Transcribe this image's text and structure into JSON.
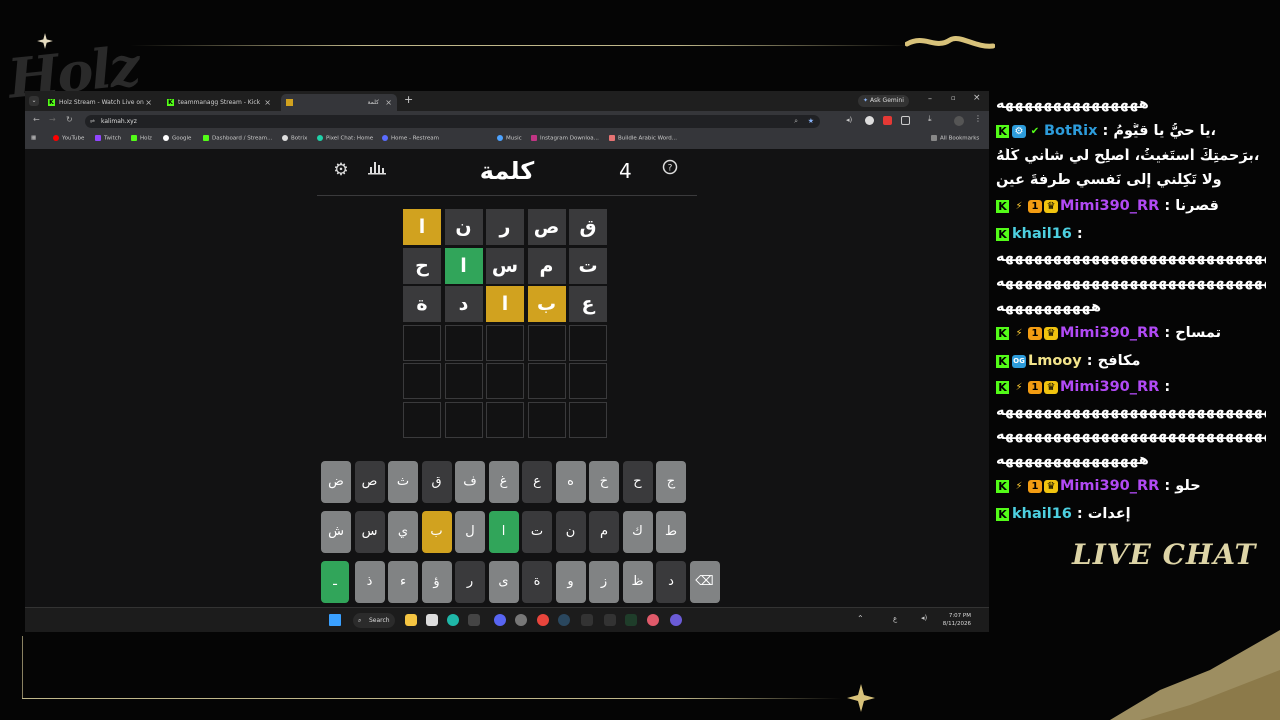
{
  "overlay": {
    "logo": "Holz",
    "live_chat": "LIVE CHAT"
  },
  "browser": {
    "tabs": [
      {
        "label": "Holz Stream - Watch Live on Kick",
        "active": false
      },
      {
        "label": "teammanagg Stream - Kick Dash...",
        "active": false
      },
      {
        "label": "كلمة",
        "active": true
      }
    ],
    "ask_gemini": "Ask Gemini",
    "url": "kalimah.xyz",
    "bookmarks": [
      "YouTube",
      "Twitch",
      "Holz",
      "Google",
      "Dashboard / Stream...",
      "Botrix",
      "Pixel Chat: Home",
      "Home - Restream",
      "Music",
      "Instagram Downloa...",
      "Buildle Arabic Word..."
    ],
    "all_bookmarks": "All Bookmarks"
  },
  "game": {
    "title": "كلمة",
    "score": "4",
    "colors": {
      "gray": "#3a3a3c",
      "green": "#31a55a",
      "yellow": "#d1a21f",
      "key": "#818384"
    },
    "rows": [
      [
        {
          "l": "ق",
          "s": "gray"
        },
        {
          "l": "ص",
          "s": "gray"
        },
        {
          "l": "ر",
          "s": "gray"
        },
        {
          "l": "ن",
          "s": "gray"
        },
        {
          "l": "ا",
          "s": "yellow"
        }
      ],
      [
        {
          "l": "ت",
          "s": "gray"
        },
        {
          "l": "م",
          "s": "gray"
        },
        {
          "l": "س",
          "s": "gray"
        },
        {
          "l": "ا",
          "s": "green"
        },
        {
          "l": "ح",
          "s": "gray"
        }
      ],
      [
        {
          "l": "ع",
          "s": "gray"
        },
        {
          "l": "ب",
          "s": "yellow"
        },
        {
          "l": "ا",
          "s": "yellow"
        },
        {
          "l": "د",
          "s": "gray"
        },
        {
          "l": "ة",
          "s": "gray"
        }
      ],
      [
        {
          "l": "",
          "s": "empty"
        },
        {
          "l": "",
          "s": "empty"
        },
        {
          "l": "",
          "s": "empty"
        },
        {
          "l": "",
          "s": "empty"
        },
        {
          "l": "",
          "s": "empty"
        }
      ],
      [
        {
          "l": "",
          "s": "empty"
        },
        {
          "l": "",
          "s": "empty"
        },
        {
          "l": "",
          "s": "empty"
        },
        {
          "l": "",
          "s": "empty"
        },
        {
          "l": "",
          "s": "empty"
        }
      ],
      [
        {
          "l": "",
          "s": "empty"
        },
        {
          "l": "",
          "s": "empty"
        },
        {
          "l": "",
          "s": "empty"
        },
        {
          "l": "",
          "s": "empty"
        },
        {
          "l": "",
          "s": "empty"
        }
      ]
    ],
    "keyboard": [
      [
        {
          "k": "ض",
          "s": "key"
        },
        {
          "k": "ص",
          "s": "dark"
        },
        {
          "k": "ث",
          "s": "key"
        },
        {
          "k": "ق",
          "s": "dark"
        },
        {
          "k": "ف",
          "s": "key"
        },
        {
          "k": "غ",
          "s": "key"
        },
        {
          "k": "ع",
          "s": "dark"
        },
        {
          "k": "ه",
          "s": "key"
        },
        {
          "k": "خ",
          "s": "key"
        },
        {
          "k": "ح",
          "s": "dark"
        },
        {
          "k": "ج",
          "s": "key"
        }
      ],
      [
        {
          "k": "ش",
          "s": "key"
        },
        {
          "k": "س",
          "s": "dark"
        },
        {
          "k": "ي",
          "s": "key"
        },
        {
          "k": "ب",
          "s": "yellow"
        },
        {
          "k": "ل",
          "s": "key"
        },
        {
          "k": "ا",
          "s": "green"
        },
        {
          "k": "ت",
          "s": "dark"
        },
        {
          "k": "ن",
          "s": "dark"
        },
        {
          "k": "م",
          "s": "dark"
        },
        {
          "k": "ك",
          "s": "key"
        },
        {
          "k": "ط",
          "s": "key"
        }
      ],
      [
        {
          "k": "ـ",
          "s": "green"
        },
        {
          "k": "ذ",
          "s": "key"
        },
        {
          "k": "ء",
          "s": "key"
        },
        {
          "k": "ؤ",
          "s": "key"
        },
        {
          "k": "ر",
          "s": "dark"
        },
        {
          "k": "ى",
          "s": "key"
        },
        {
          "k": "ة",
          "s": "dark"
        },
        {
          "k": "و",
          "s": "key"
        },
        {
          "k": "ز",
          "s": "key"
        },
        {
          "k": "ظ",
          "s": "key"
        },
        {
          "k": "د",
          "s": "dark"
        },
        {
          "k": "⌫",
          "s": "key"
        }
      ]
    ]
  },
  "taskbar": {
    "search": "Search",
    "time": "7:07 PM",
    "date": "8/11/2026"
  },
  "chat": [
    {
      "text": "هههههههههههههههه",
      "user": "",
      "color": "#ffffff"
    },
    {
      "user": "BotRix",
      "color": "#2d9cdb",
      "text": "يا حيُّ يا قيُّومُ،"
    },
    {
      "text": "برَحمتِكَ أستَغيثُ، أصلِح لي شأني كُلَّهُ،",
      "user": ""
    },
    {
      "text": "ولا تَكِلني إلى نَفسي طرفةَ عينٍ",
      "user": ""
    },
    {
      "user": "Mimi390_RR",
      "color": "#b14af5",
      "text": "قصرنا"
    },
    {
      "user": "khail16",
      "color": "#4dd0e1",
      "text": ""
    },
    {
      "text": "هههههههههههههههههههههههههههههههههههه",
      "user": ""
    },
    {
      "text": "ههههههههههههههههههههههههههههههههههه",
      "user": ""
    },
    {
      "text": "ههههههههههه",
      "user": ""
    },
    {
      "user": "Mimi390_RR",
      "color": "#b14af5",
      "text": "تمساح"
    },
    {
      "user": "Lmooy",
      "color": "#f3e48b",
      "text": "مكافح"
    },
    {
      "user": "Mimi390_RR",
      "color": "#b14af5",
      "text": ""
    },
    {
      "text": "هههههههههههههههههههههههههههههههههههه",
      "user": ""
    },
    {
      "text": "ههههههههههههههههههههههههههههههههههه",
      "user": ""
    },
    {
      "text": "هههههههههههههههه",
      "user": ""
    },
    {
      "user": "Mimi390_RR",
      "color": "#b14af5",
      "text": "حلو"
    },
    {
      "user": "khail16",
      "color": "#4dd0e1",
      "text": "إعدات"
    }
  ]
}
